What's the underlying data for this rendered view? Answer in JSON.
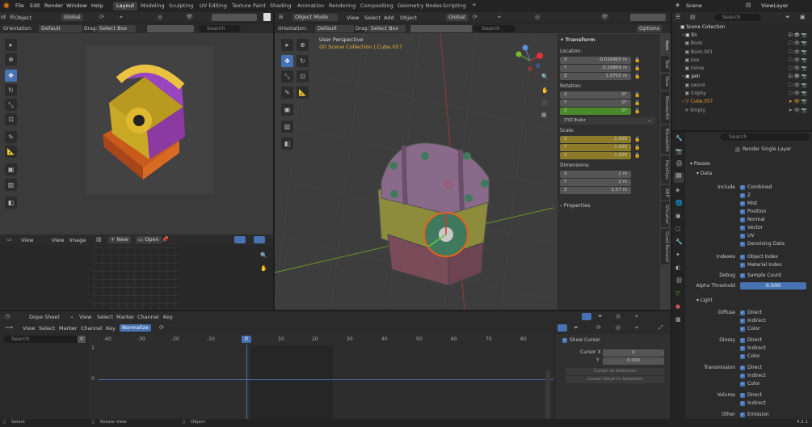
{
  "menu": [
    "File",
    "Edit",
    "Render",
    "Window",
    "Help"
  ],
  "workspaces": [
    "Layout",
    "Modeling",
    "Sculpting",
    "UV Editing",
    "Texture Paint",
    "Shading",
    "Animation",
    "Rendering",
    "Compositing",
    "Geometry Nodes",
    "Scripting"
  ],
  "scene_name": "Scene",
  "viewlayer_name": "ViewLayer",
  "left_editor": {
    "edge_label": "id",
    "mode": "Object",
    "transform_space": "Global",
    "orientation_label": "Orientation:",
    "orientation": "Default",
    "drag_label": "Drag:",
    "drag": "Select Box",
    "search_placeholder": "Search"
  },
  "image_editor": {
    "view_menu": "View",
    "view2": "View",
    "image": "Image",
    "new_btn": "New",
    "open_btn": "Open"
  },
  "viewport": {
    "mode": "Object Mode",
    "menus": [
      "View",
      "Select",
      "Add",
      "Object"
    ],
    "transform_space": "Global",
    "orientation_label": "Orientation:",
    "orientation": "Default",
    "drag_label": "Drag:",
    "drag": "Select Box",
    "search_placeholder": "Search",
    "options": "Options",
    "perspective": "User Perspective",
    "collection_info": "(0) Scene Collection | Cube.057"
  },
  "n_panel": {
    "tabs": [
      "Item",
      "Tool",
      "View",
      "BlenderKit",
      "BlenderKit",
      "HardOps",
      "ABP",
      "GScatter",
      "Quad Remesh"
    ],
    "transform": "Transform",
    "location": "Location:",
    "loc": [
      {
        "a": "X",
        "v": "-0.016905 m"
      },
      {
        "a": "Y",
        "v": "0.19869 m"
      },
      {
        "a": "Z",
        "v": "1.0755 m"
      }
    ],
    "rotation": "Rotation:",
    "rot": [
      {
        "a": "X",
        "v": "0°"
      },
      {
        "a": "Y",
        "v": "0°"
      },
      {
        "a": "Z",
        "v": "0°"
      }
    ],
    "rot_mode": "XYZ Euler",
    "scale": "Scale:",
    "scl": [
      {
        "a": "X",
        "v": "1.000"
      },
      {
        "a": "Y",
        "v": "1.000"
      },
      {
        "a": "Z",
        "v": "1.000"
      }
    ],
    "dimensions": "Dimensions:",
    "dim": [
      {
        "a": "X",
        "v": "2 m"
      },
      {
        "a": "Y",
        "v": "2 m"
      },
      {
        "a": "Z",
        "v": "1.57 m"
      }
    ],
    "properties": "Properties"
  },
  "outliner": {
    "search_placeholder": "Search",
    "root": "Scene Collection",
    "items": [
      "En",
      "Book",
      "Book.001",
      "box",
      "home",
      "pell",
      "sword",
      "trophy",
      "Cube.057",
      "Empty"
    ]
  },
  "properties": {
    "search_placeholder": "Search",
    "render_single_layer": "Render Single Layer",
    "passes": "Passes",
    "data": "Data",
    "include_label": "Include",
    "include": [
      "Combined",
      "Z",
      "Mist",
      "Position",
      "Normal",
      "Vector",
      "UV",
      "Denoising Data"
    ],
    "indexes_label": "Indexes",
    "indexes": [
      "Object Index",
      "Material Index"
    ],
    "debug_label": "Debug",
    "debug": [
      "Sample Count"
    ],
    "alpha_label": "Alpha Threshold",
    "alpha_value": "0.500",
    "light": "Light",
    "diffuse_label": "Diffuse",
    "diffuse": [
      "Direct",
      "Indirect",
      "Color"
    ],
    "glossy_label": "Glossy",
    "glossy": [
      "Direct",
      "Indirect",
      "Color"
    ],
    "transmission_label": "Transmission",
    "transmission": [
      "Direct",
      "Indirect",
      "Color"
    ],
    "volume_label": "Volume",
    "volume": [
      "Direct",
      "Indirect"
    ],
    "other_label": "Other",
    "other": [
      "Emission"
    ]
  },
  "dopesheet": {
    "mode": "Dope Sheet",
    "menus": [
      "View",
      "Select",
      "Marker",
      "Channel",
      "Key"
    ],
    "menus2": [
      "View",
      "Select",
      "Marker",
      "Channel",
      "Key"
    ],
    "normalize": "Normalize",
    "search_placeholder": "Search",
    "frames": [
      "-40",
      "-30",
      "-20",
      "-10",
      "0",
      "10",
      "20",
      "30",
      "40",
      "50",
      "60",
      "70",
      "80"
    ],
    "current_frame": "0",
    "channel_one": "1",
    "channel_zero": "0",
    "show_cursor": "Show Cursor",
    "cursor_x_label": "Cursor X",
    "cursor_x": "0",
    "cursor_y_label": "Y",
    "cursor_y": "0.000",
    "cursor_to_selection": "Cursor to Selection",
    "cursor_value_to_selection": "Cursor Value to Selection"
  },
  "status": {
    "select": "Select",
    "rotate": "Rotate View",
    "object": "Object",
    "version": "4.2.1"
  }
}
